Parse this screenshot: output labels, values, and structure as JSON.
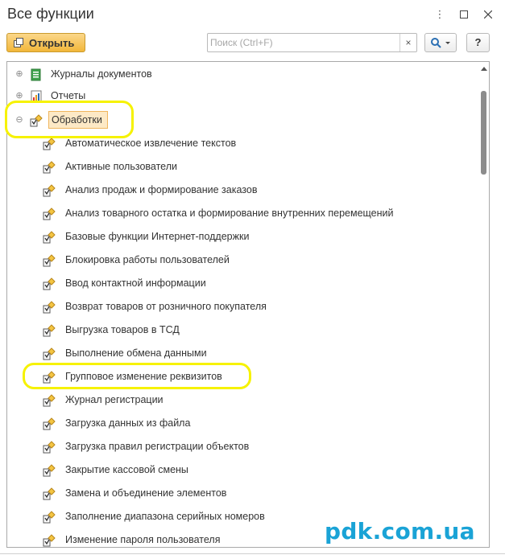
{
  "window": {
    "title": "Все функции"
  },
  "toolbar": {
    "open_label": "Открыть",
    "search_placeholder": "Поиск (Ctrl+F)",
    "clear_symbol": "×",
    "help_label": "?"
  },
  "tree": {
    "top_items": [
      {
        "label": "Журналы документов",
        "icon": "journal-icon",
        "expanded": false
      },
      {
        "label": "Отчеты",
        "icon": "report-icon",
        "expanded": false
      },
      {
        "label": "Обработки",
        "icon": "processing-icon",
        "expanded": true,
        "selected": true
      }
    ],
    "children": [
      "Автоматическое извлечение текстов",
      "Активные пользователи",
      "Анализ продаж и формирование заказов",
      "Анализ товарного остатка и формирование внутренних перемещений",
      "Базовые функции Интернет-поддержки",
      "Блокировка работы пользователей",
      "Ввод контактной информации",
      "Возврат товаров от розничного покупателя",
      "Выгрузка товаров в ТСД",
      "Выполнение обмена данными",
      "Групповое изменение реквизитов",
      "Журнал регистрации",
      "Загрузка данных из файла",
      "Загрузка правил регистрации объектов",
      "Закрытие кассовой смены",
      "Замена и объединение элементов",
      "Заполнение диапазона серийных номеров",
      "Изменение пароля пользователя"
    ]
  },
  "colors": {
    "accent": "#f2b73a",
    "selection": "#fde9c6",
    "highlight": "#f6f200",
    "watermark": "#1aa3d6"
  },
  "watermark": "pdk.com.ua"
}
